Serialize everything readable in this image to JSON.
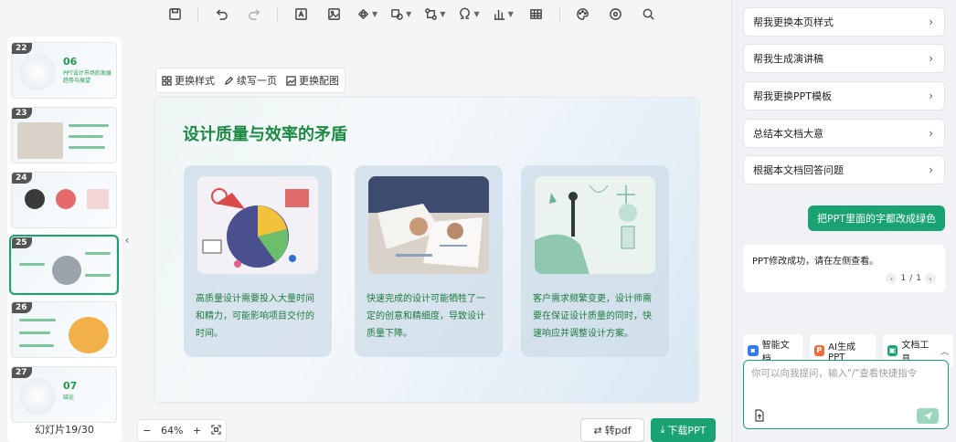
{
  "toolbar": {
    "icons": [
      "save-icon",
      "undo-icon",
      "redo-icon",
      "textbox-icon",
      "image-icon",
      "shape-icon",
      "chart-icon",
      "flow-icon",
      "symbol-icon",
      "bar-chart-icon",
      "table-icon",
      "palette-icon",
      "target-icon",
      "search-icon"
    ]
  },
  "thumbnails": [
    {
      "num": "22",
      "title": "06",
      "sub": "PPT设计市场的发展趋势与展望"
    },
    {
      "num": "23",
      "title": "",
      "sub": ""
    },
    {
      "num": "24",
      "title": "",
      "sub": ""
    },
    {
      "num": "25",
      "title": "",
      "sub": ""
    },
    {
      "num": "26",
      "title": "",
      "sub": ""
    },
    {
      "num": "27",
      "title": "07",
      "sub": "结论"
    }
  ],
  "thumbs_footer": "幻灯片19/30",
  "slide_tools": {
    "change_style": "更换样式",
    "continue_page": "续写一页",
    "change_image": "更换配图"
  },
  "slide": {
    "title": "设计质量与效率的矛盾",
    "cards": [
      {
        "text": "高质量设计需要投入大量时间和精力，可能影响项目交付的时间。"
      },
      {
        "text": "快速完成的设计可能牺牲了一定的创意和精细度，导致设计质量下降。"
      },
      {
        "text": "客户需求频繁变更，设计师需要在保证设计质量的同时，快速响应并调整设计方案。"
      }
    ]
  },
  "zoom": {
    "minus": "−",
    "value": "64%",
    "plus": "+"
  },
  "buttons": {
    "to_pdf": "转pdf",
    "download_ppt": "下载PPT"
  },
  "panel": {
    "suggestions": [
      "帮我更换本页样式",
      "帮我生成演讲稿",
      "帮我更换PPT模板",
      "总结本文档大意",
      "根据本文档回答问题"
    ],
    "user_message": "把PPT里面的字都改成绿色",
    "bot_message": "PPT修改成功，请在左侧查看。",
    "pager": {
      "current": "1",
      "sep": "/",
      "total": "1"
    },
    "tools": [
      {
        "label": "智能文档",
        "color": "#2f7bf0",
        "icon": "doc-icon"
      },
      {
        "label": "AI生成PPT",
        "color": "#f06a3a",
        "icon": "ppt-icon"
      },
      {
        "label": "文档工具",
        "color": "#1aa372",
        "icon": "tools-icon"
      }
    ],
    "input_placeholder": "你可以向我提问，输入\"/\"查看快捷指令"
  }
}
